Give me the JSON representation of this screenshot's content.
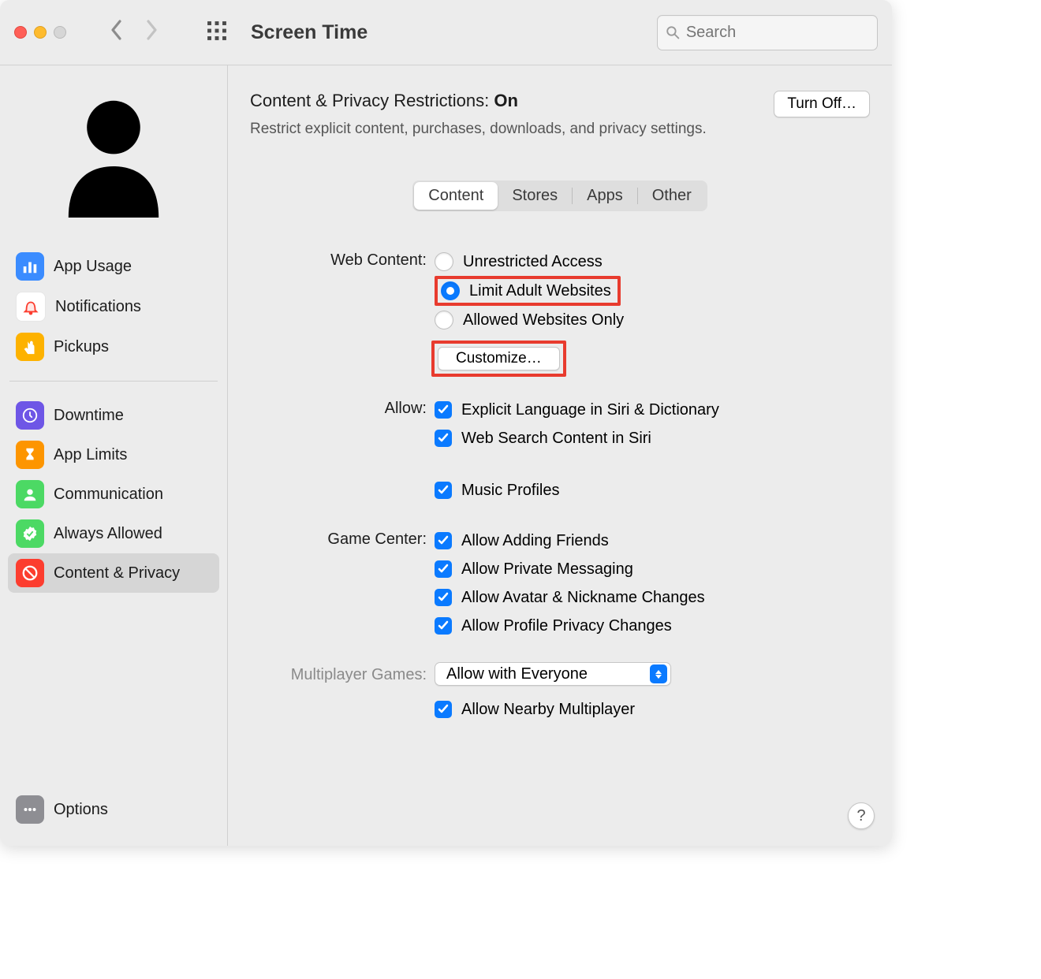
{
  "toolbar": {
    "title": "Screen Time",
    "search_placeholder": "Search"
  },
  "sidebar": {
    "items_a": [
      {
        "label": "App Usage",
        "color": "#3b8cff"
      },
      {
        "label": "Notifications",
        "color": "#ffffff"
      },
      {
        "label": "Pickups",
        "color": "#fdb200"
      }
    ],
    "items_b": [
      {
        "label": "Downtime",
        "color": "#6e56e6"
      },
      {
        "label": "App Limits",
        "color": "#fd9500"
      },
      {
        "label": "Communication",
        "color": "#4cd964"
      },
      {
        "label": "Always Allowed",
        "color": "#4cd964"
      },
      {
        "label": "Content & Privacy",
        "color": "#fc3d2f"
      }
    ],
    "footer": {
      "label": "Options"
    }
  },
  "main": {
    "title_prefix": "Content & Privacy Restrictions: ",
    "title_state": "On",
    "subtitle": "Restrict explicit content, purchases, downloads, and privacy settings.",
    "turn_off": "Turn Off…",
    "tabs": [
      "Content",
      "Stores",
      "Apps",
      "Other"
    ],
    "web_content": {
      "label": "Web Content:",
      "options": [
        "Unrestricted Access",
        "Limit Adult Websites",
        "Allowed Websites Only"
      ],
      "customize": "Customize…"
    },
    "allow": {
      "label": "Allow:",
      "options": [
        "Explicit Language in Siri & Dictionary",
        "Web Search Content in Siri",
        "Music Profiles"
      ]
    },
    "game_center": {
      "label": "Game Center:",
      "options": [
        "Allow Adding Friends",
        "Allow Private Messaging",
        "Allow Avatar & Nickname Changes",
        "Allow Profile Privacy Changes"
      ]
    },
    "multiplayer": {
      "label": "Multiplayer Games:",
      "select_value": "Allow with Everyone",
      "nearby": "Allow Nearby Multiplayer"
    },
    "help": "?"
  }
}
